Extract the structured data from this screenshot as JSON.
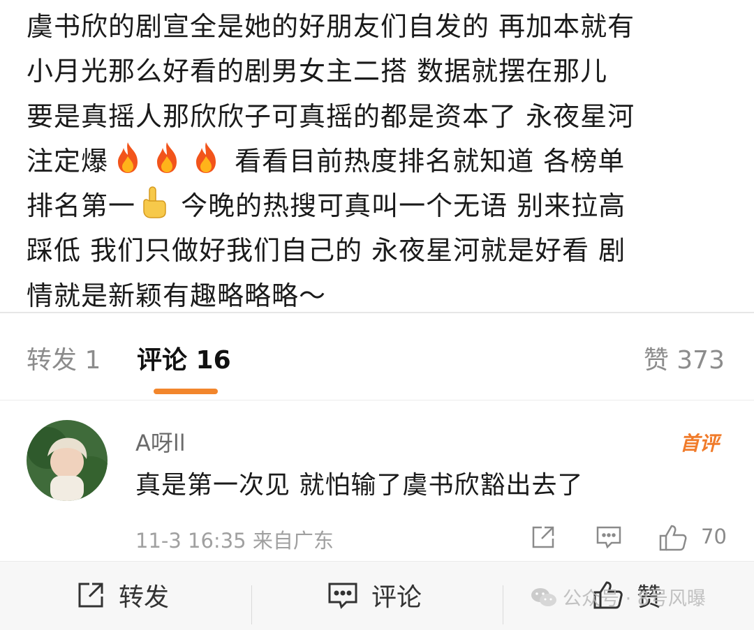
{
  "post": {
    "lines": [
      "虞书欣的剧宣全是她的好朋友们自发的 再加本就有",
      "小月光那么好看的剧男女主二搭 数据就摆在那儿",
      "要是真摇人那欣欣子可真摇的都是资本了 永夜星河",
      "注定爆",
      "看看目前热度排名就知道 各榜单",
      "排名第一",
      "今晚的热搜可真叫一个无语 别来拉高",
      "踩低 我们只做好我们自己的 永夜星河就是好看 剧",
      "情就是新颖有趣略略略～"
    ],
    "emojis": [
      "fire-icon",
      "fire-icon",
      "fire-icon",
      "pointing-up-icon"
    ]
  },
  "tabs": {
    "repost": "转发 1",
    "comment": "评论 16",
    "like": "赞 373",
    "accent": "#f2862c"
  },
  "comment": {
    "user": "A呀ll",
    "badge": "首评",
    "text": "真是第一次见  就怕输了虞书欣豁出去了",
    "meta": "11-3 16:35 来自广东",
    "likes": "70"
  },
  "bottom_bar": {
    "repost": "转发",
    "comment": "评论",
    "like": "赞"
  },
  "watermark": "公众号 · 8号风曝"
}
